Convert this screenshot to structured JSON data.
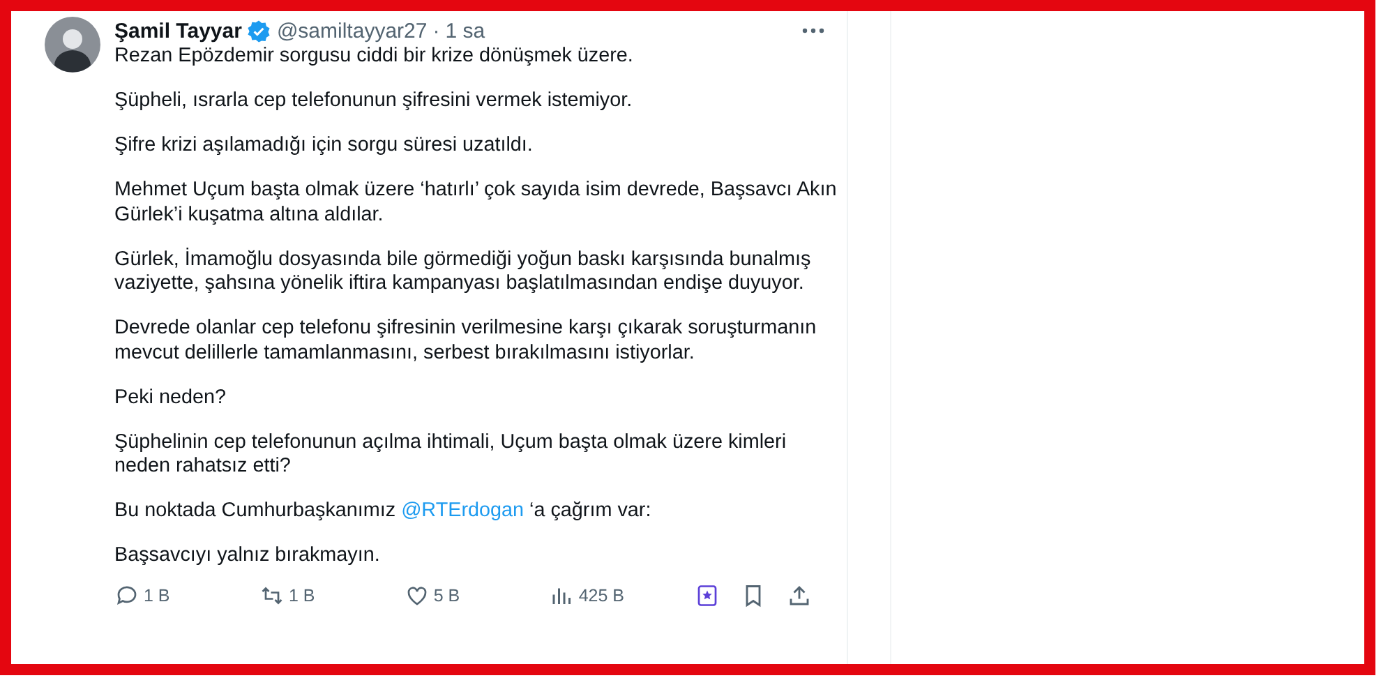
{
  "author": {
    "name": "Şamil Tayyar",
    "verified": true,
    "handle": "@samiltayyar27",
    "separator": "·",
    "time": "1 sa"
  },
  "paragraphs": [
    [
      {
        "kind": "plain",
        "text": "Rezan Epözdemir sorgusu ciddi bir krize dönüşmek üzere."
      }
    ],
    [
      {
        "kind": "plain",
        "text": "Şüpheli, ısrarla cep telefonunun şifresini vermek istemiyor."
      }
    ],
    [
      {
        "kind": "plain",
        "text": "Şifre krizi aşılamadığı için sorgu süresi uzatıldı."
      }
    ],
    [
      {
        "kind": "plain",
        "text": "Mehmet Uçum başta olmak üzere ‘hatırlı’ çok sayıda isim devrede, Başsavcı Akın Gürlek’i kuşatma altına aldılar."
      }
    ],
    [
      {
        "kind": "plain",
        "text": "Gürlek, İmamoğlu dosyasında bile görmediği yoğun baskı karşısında bunalmış vaziyette, şahsına yönelik iftira kampanyası başlatılmasından endişe duyuyor."
      }
    ],
    [
      {
        "kind": "plain",
        "text": "Devrede olanlar cep telefonu şifresinin verilmesine karşı çıkarak soruşturmanın mevcut delillerle tamamlanmasını, serbest bırakılmasını istiyorlar."
      }
    ],
    [
      {
        "kind": "plain",
        "text": "Peki neden?"
      }
    ],
    [
      {
        "kind": "plain",
        "text": "Şüphelinin cep telefonunun açılma ihtimali, Uçum başta olmak üzere kimleri neden rahatsız etti?"
      }
    ],
    [
      {
        "kind": "plain",
        "text": "Bu noktada Cumhurbaşkanımız "
      },
      {
        "kind": "mention",
        "text": "@RTErdogan"
      },
      {
        "kind": "plain",
        "text": " ‘a çağrım var:"
      }
    ],
    [
      {
        "kind": "plain",
        "text": "Başsavcıyı yalnız bırakmayın."
      }
    ]
  ],
  "actions": [
    {
      "kind": "reply",
      "count": "1 B"
    },
    {
      "kind": "repost",
      "count": "1 B"
    },
    {
      "kind": "like",
      "count": "5 B"
    },
    {
      "kind": "views",
      "count": "425 B"
    },
    {
      "kind": "grok"
    },
    {
      "kind": "bookmark"
    },
    {
      "kind": "share"
    }
  ]
}
